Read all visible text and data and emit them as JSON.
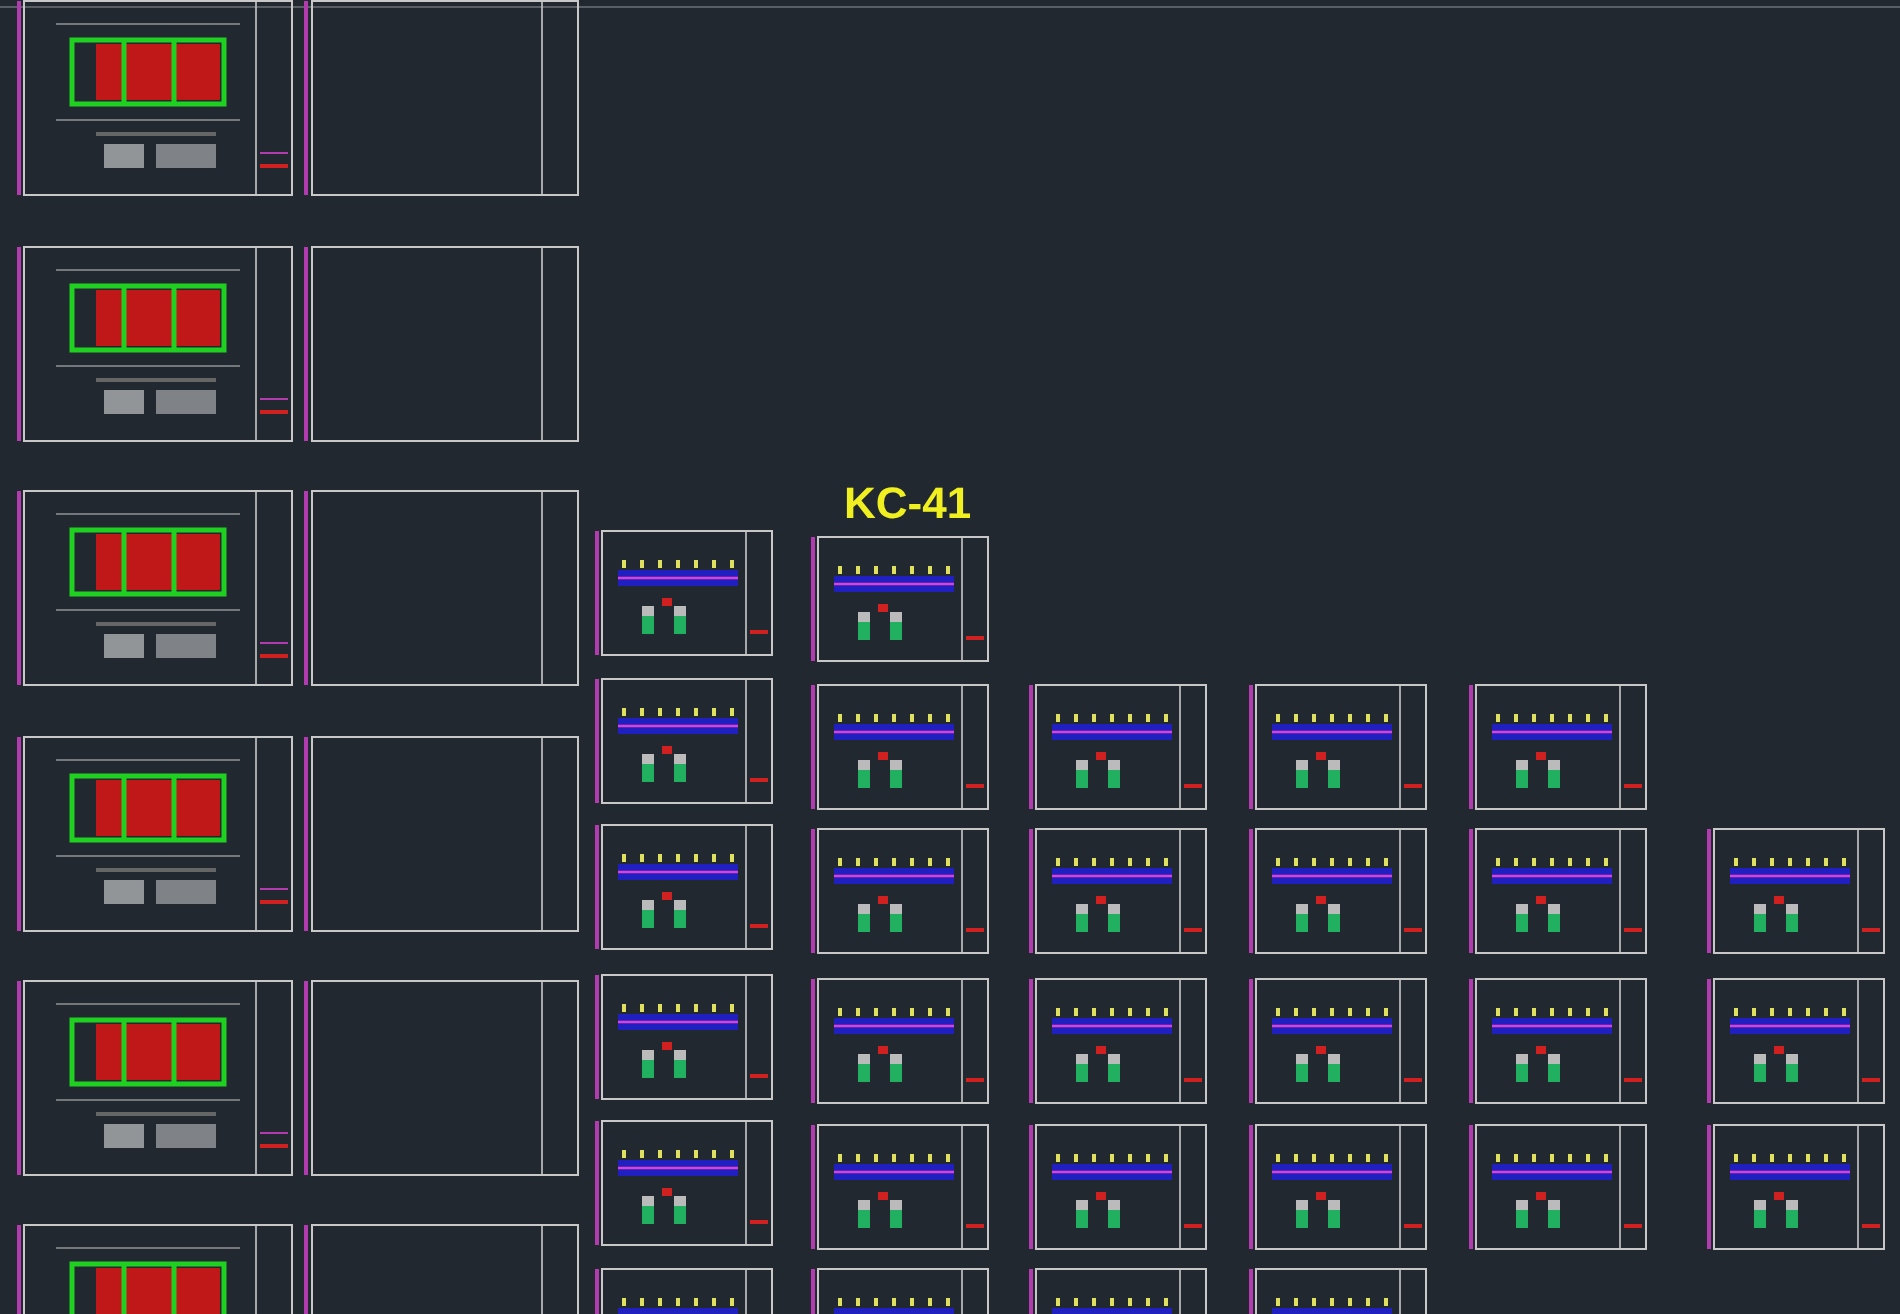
{
  "drawing_label": "KC-41"
}
